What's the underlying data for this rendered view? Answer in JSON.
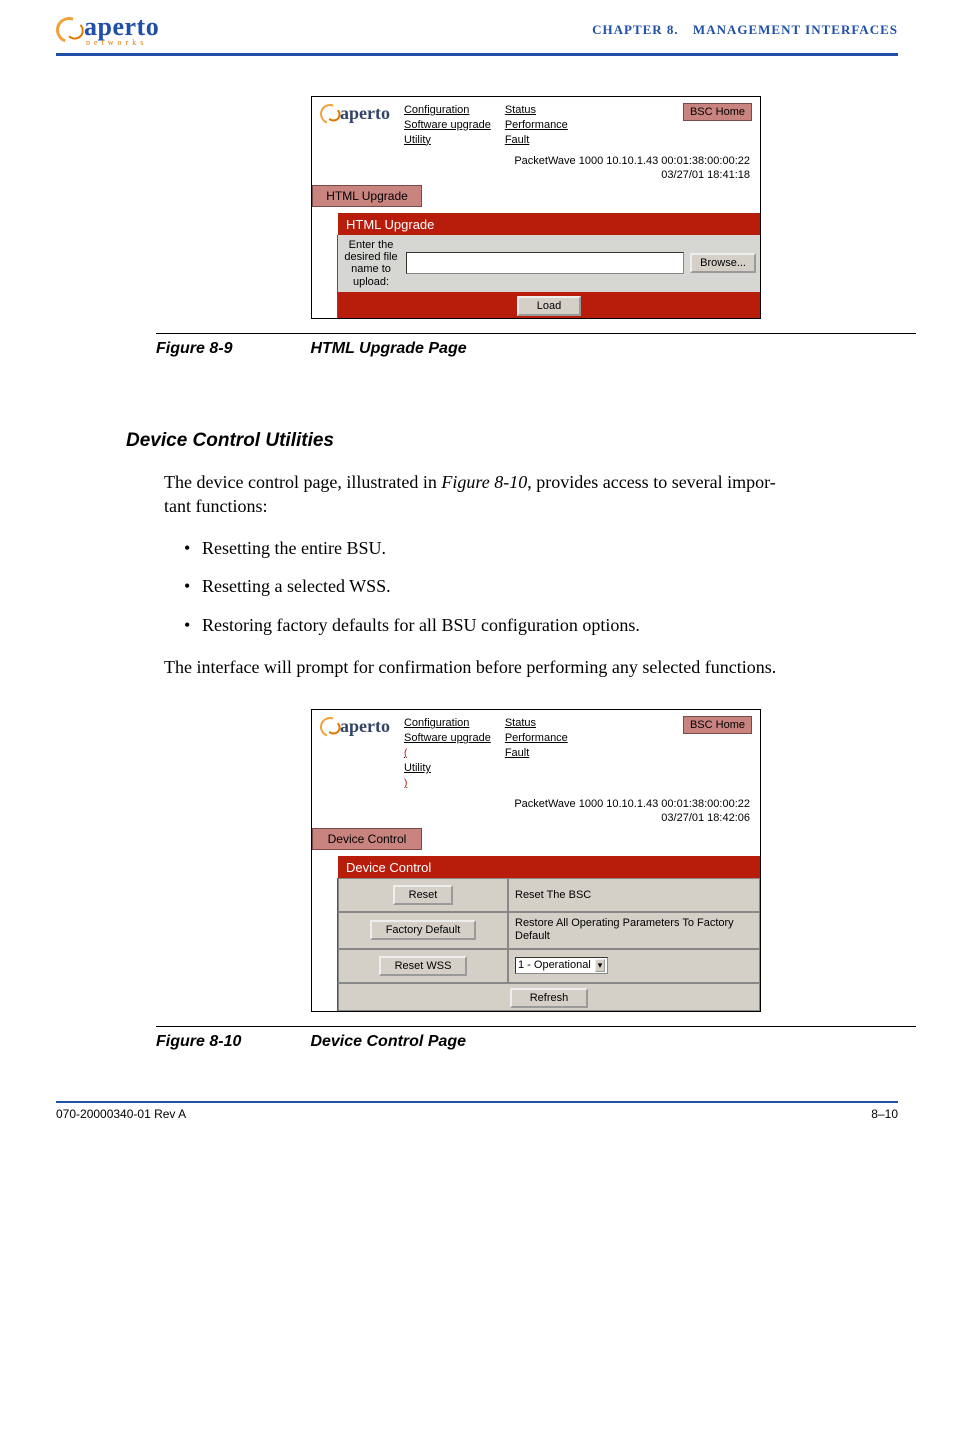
{
  "header": {
    "logo_text": "aperto",
    "logo_sub": "n e t w o r k s",
    "chapter": "CHAPTER 8.",
    "title": "MANAGEMENT INTERFACES"
  },
  "figure1": {
    "id": "Figure 8-9",
    "caption": "HTML Upgrade Page",
    "screenshot": {
      "logo": "aperto",
      "menu_col1": {
        "a": "Configuration",
        "b": "Software upgrade",
        "c": "Utility"
      },
      "menu_col2": {
        "a": "Status",
        "b": "Performance",
        "c": "Fault"
      },
      "home_btn": "BSC Home",
      "info_line1": "PacketWave 1000    10.10.1.43    00:01:38:00:00:22",
      "info_line2": "03/27/01    18:41:18",
      "side_btn": "HTML Upgrade",
      "section_header": "HTML Upgrade",
      "upload_label": "Enter the desired file name to upload:",
      "browse_btn": "Browse...",
      "load_btn": "Load"
    }
  },
  "section": {
    "heading": "Device Control Utilities",
    "para1_a": "The device control page, illustrated in ",
    "para1_ref": "Figure 8-10",
    "para1_b": ", provides access to several impor-",
    "para1_c": "tant functions:",
    "bullet1": "Resetting the entire BSU.",
    "bullet2": "Resetting a selected WSS.",
    "bullet3_a": "Restoring factory defaults for ",
    "bullet3_ital": "all",
    "bullet3_b": " BSU configuration options.",
    "para2": "The interface will prompt for confirmation before performing any selected functions."
  },
  "figure2": {
    "id": "Figure 8-10",
    "caption": "Device Control Page",
    "screenshot": {
      "logo": "aperto",
      "menu_col1": {
        "a": "Configuration",
        "b": "Software upgrade",
        "c": "Utility"
      },
      "menu_col2": {
        "a": "Status",
        "b": "Performance",
        "c": "Fault"
      },
      "home_btn": "BSC Home",
      "info_line1": "PacketWave 1000    10.10.1.43    00:01:38:00:00:22",
      "info_line2": "03/27/01    18:42:06",
      "side_btn": "Device Control",
      "section_header": "Device Control",
      "row1_btn": "Reset",
      "row1_txt": "Reset The BSC",
      "row2_btn": "Factory Default",
      "row2_txt": "Restore All Operating Parameters To Factory Default",
      "row3_btn": "Reset WSS",
      "row3_select": "1 - Operational",
      "refresh_btn": "Refresh"
    }
  },
  "footer": {
    "left": "070-20000340-01 Rev A",
    "right": "8–10"
  }
}
